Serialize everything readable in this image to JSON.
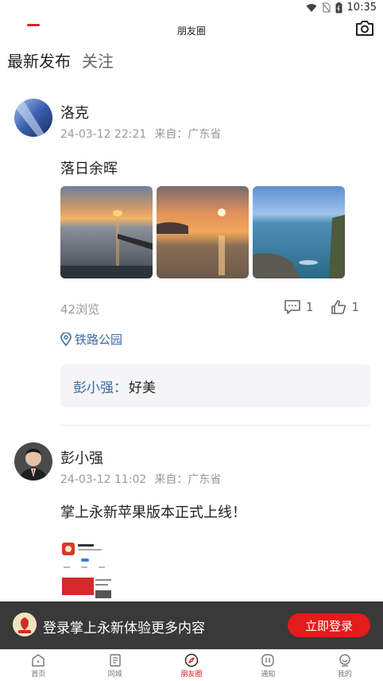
{
  "status_bar": {
    "time": "10:35"
  },
  "header": {
    "title": "朋友圈"
  },
  "tabs": [
    {
      "label": "最新发布",
      "active": true
    },
    {
      "label": "关注",
      "active": false
    }
  ],
  "posts": [
    {
      "author": "洛克",
      "time": "24-03-12 22:21",
      "from": "来自：广东省",
      "text": "落日余晖",
      "views": "42浏览",
      "comments_count": "1",
      "likes_count": "1",
      "location": "铁路公园",
      "comment": {
        "user": "彭小强",
        "sep": "：",
        "text": "好美"
      }
    },
    {
      "author": "彭小强",
      "time": "24-03-12 11:02",
      "from": "来自：广东省",
      "text": "掌上永新苹果版本正式上线！"
    }
  ],
  "login_banner": {
    "text": "登录掌上永新体验更多内容",
    "button": "立即登录"
  },
  "bottom_nav": [
    {
      "label": "首页",
      "icon": "home-icon"
    },
    {
      "label": "同城",
      "icon": "city-icon"
    },
    {
      "label": "朋友圈",
      "icon": "compass-icon",
      "active": true
    },
    {
      "label": "通知",
      "icon": "notification-icon"
    },
    {
      "label": "我的",
      "icon": "profile-icon"
    }
  ],
  "colors": {
    "accent": "#e02020",
    "link": "#3a6aa0",
    "banner_bg": "#282828"
  }
}
